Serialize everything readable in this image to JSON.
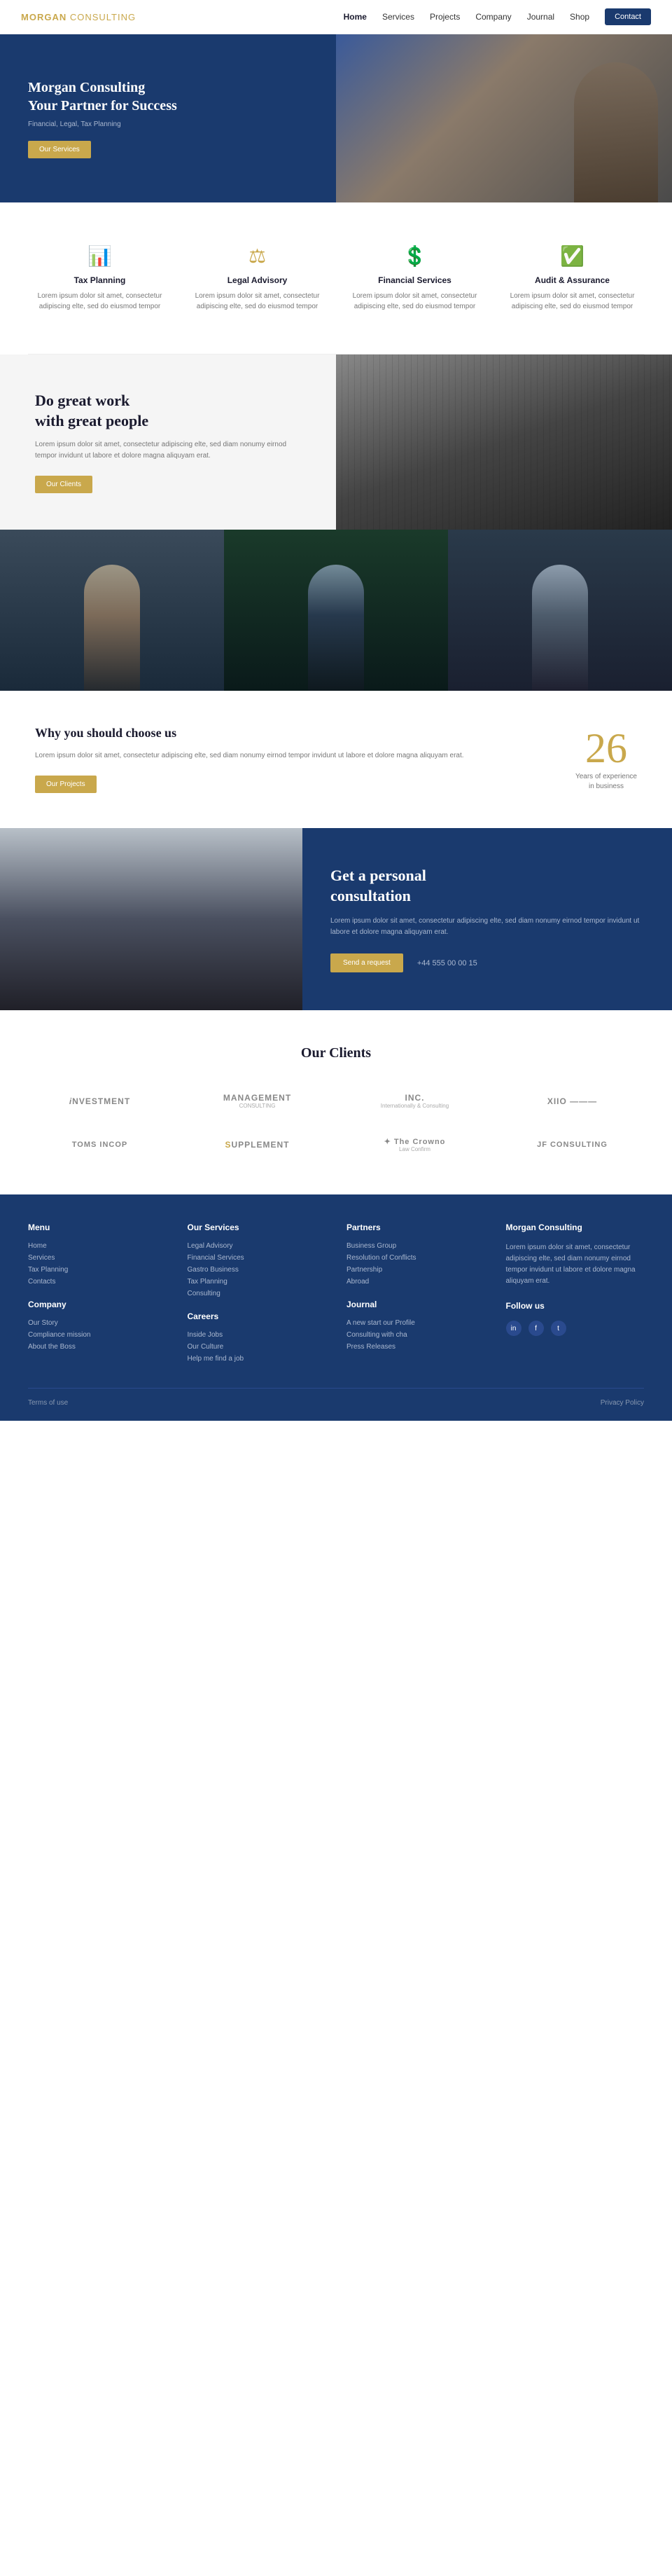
{
  "navbar": {
    "logo_first": "MORGAN",
    "logo_second": "CONSULTING",
    "links": [
      {
        "label": "Home",
        "active": true
      },
      {
        "label": "Services",
        "active": false
      },
      {
        "label": "Projects",
        "active": false
      },
      {
        "label": "Company",
        "active": false
      },
      {
        "label": "Journal",
        "active": false
      },
      {
        "label": "Shop",
        "active": false
      }
    ],
    "contact_label": "Contact"
  },
  "hero": {
    "title": "Morgan Consulting\nYour Partner for Success",
    "subtitle": "Financial, Legal, Tax Planning",
    "button_label": "Our Services"
  },
  "services": {
    "items": [
      {
        "icon": "📊",
        "title": "Tax Planning",
        "desc": "Lorem ipsum dolor sit amet, consectetur adipiscing elte, sed do eiusmod tempor"
      },
      {
        "icon": "⚖",
        "title": "Legal Advisory",
        "desc": "Lorem ipsum dolor sit amet, consectetur adipiscing elte, sed do eiusmod tempor"
      },
      {
        "icon": "$",
        "title": "Financial Services",
        "desc": "Lorem ipsum dolor sit amet, consectetur adipiscing elte, sed do eiusmod tempor"
      },
      {
        "icon": "✓",
        "title": "Audit & Assurance",
        "desc": "Lorem ipsum dolor sit amet, consectetur adipiscing elte, sed do eiusmod tempor"
      }
    ]
  },
  "great_work": {
    "title": "Do great work\nwith great people",
    "desc": "Lorem ipsum dolor sit amet, consectetur adipiscing elte, sed diam nonumy eirnod tempor invidunt ut labore et dolore magna aliquyam erat.",
    "button_label": "Our Clients"
  },
  "why": {
    "title": "Why you should choose us",
    "desc": "Lorem ipsum dolor sit amet, consectetur adipiscing elte, sed diam nonumy eirnod tempor invidunt ut labore et dolore magna aliquyam erat.",
    "button_label": "Our Projects",
    "stat_number": "26",
    "stat_label": "Years of experience\nin business"
  },
  "consult": {
    "title": "Get a personal\nconsultation",
    "desc": "Lorem ipsum dolor sit amet, consectetur adipiscing elte, sed diam nonumy eirnod tempor invidunt ut labore et dolore magna aliquyam erat.",
    "button_label": "Send a request",
    "phone": "+44 555 00 00 15"
  },
  "clients": {
    "title": "Our Clients",
    "logos": [
      {
        "name": "INVESTMENT",
        "sub": ""
      },
      {
        "name": "MANAGEMENT",
        "sub": "CONSULTING"
      },
      {
        "name": "INC.",
        "sub": "Internationally & Consulting"
      },
      {
        "name": "XIIO",
        "sub": "—————"
      },
      {
        "name": "TOMS INCOP",
        "sub": ""
      },
      {
        "name": "SUPPLEMENT",
        "sub": ""
      },
      {
        "name": "The Crowno",
        "sub": "Law Confirm"
      },
      {
        "name": "JF CONSULTING",
        "sub": ""
      }
    ]
  },
  "footer": {
    "menu_title": "Menu",
    "menu_items": [
      "Home",
      "Services",
      "Tax Planning",
      "Contacts"
    ],
    "services_title": "Our Services",
    "services_items": [
      "Legal Advisory",
      "Financial Services",
      "Gastro Business",
      "Tax Planning",
      "Consulting"
    ],
    "partners_title": "Partners",
    "partners_items": [
      "Business Group",
      "Resolution of Conflicts",
      "Partnership",
      "Abroad"
    ],
    "company_title": "Morgan Consulting",
    "company_desc": "Lorem ipsum dolor sit amet, consectetur adipiscing elte, sed diam nonumy eirnod tempor invidunt ut labore et dolore magna aliquyam erat.",
    "company_section_title": "Company",
    "company_links": [
      "Our Story",
      "Compliance mission",
      "About the Boss"
    ],
    "careers_title": "Careers",
    "careers_items": [
      "Inside Jobs",
      "Our Culture",
      "Help me find a job"
    ],
    "journal_title": "Journal",
    "journal_items": [
      "A new start our Profile",
      "Consulting with cha",
      "Press Releases"
    ],
    "follow_title": "Follow us",
    "social_icons": [
      "in",
      "f",
      "t"
    ],
    "terms_label": "Terms of use",
    "privacy_label": "Privacy Policy"
  }
}
